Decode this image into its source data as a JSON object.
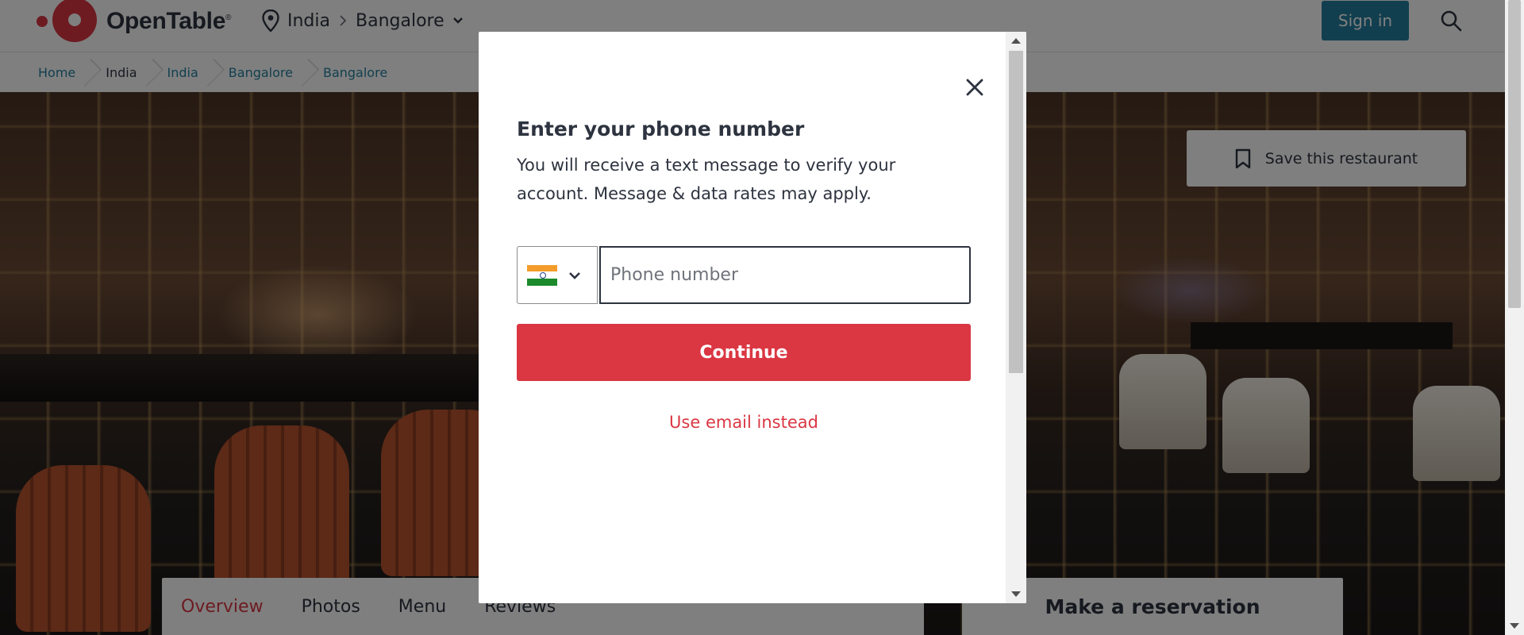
{
  "header": {
    "brand": "OpenTable",
    "brand_mark": "®",
    "location": {
      "country": "India",
      "city": "Bangalore"
    },
    "signin_label": "Sign in"
  },
  "breadcrumb": [
    "Home",
    "India",
    "India",
    "Bangalore",
    "Bangalore"
  ],
  "hero": {
    "save_label": "Save this restaurant"
  },
  "tabs": [
    "Overview",
    "Photos",
    "Menu",
    "Reviews"
  ],
  "reservation": {
    "title": "Make a reservation"
  },
  "modal": {
    "title": "Enter your phone number",
    "description": "You will receive a text message to verify your account. Message & data rates may apply.",
    "country_flag": "India",
    "phone_placeholder": "Phone number",
    "phone_value": "",
    "continue_label": "Continue",
    "email_link": "Use email instead"
  },
  "colors": {
    "brand_red": "#da3743",
    "signin_blue": "#247f9e",
    "text": "#2d333f"
  },
  "icons": [
    "location-pin-icon",
    "chevron-right-icon",
    "chevron-down-icon",
    "search-icon",
    "bookmark-icon",
    "close-icon",
    "india-flag-icon"
  ]
}
